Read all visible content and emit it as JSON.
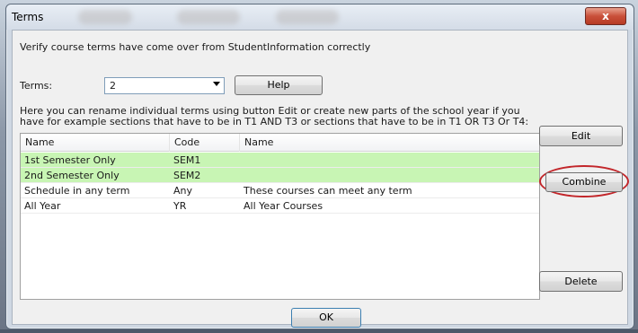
{
  "window": {
    "title": "Terms",
    "close_label": "x"
  },
  "verify_text": "Verify course terms have come over from StudentInformation correctly",
  "terms": {
    "label": "Terms:",
    "selected": "2"
  },
  "help_label": "Help",
  "description": "Here you can rename individual terms using button Edit or create new parts of the school year if you have for example sections that have to be in T1 AND T3 or sections that have to be in T1 OR T3 Or T4:",
  "grid": {
    "columns": [
      "Name",
      "Code",
      "Name"
    ],
    "rows": [
      {
        "name": "1st Semester Only",
        "code": "SEM1",
        "desc": "",
        "highlight": true
      },
      {
        "name": "2nd Semester Only",
        "code": "SEM2",
        "desc": "",
        "highlight": true
      },
      {
        "name": "Schedule in any term",
        "code": "Any",
        "desc": "These courses can meet any term",
        "highlight": false
      },
      {
        "name": "All Year",
        "code": "YR",
        "desc": "All Year Courses",
        "highlight": false
      }
    ]
  },
  "buttons": {
    "edit": "Edit",
    "combine": "Combine",
    "delete": "Delete",
    "ok": "OK"
  },
  "colors": {
    "highlight_row": "#c8f5b4",
    "annotation_ring": "#c2262a",
    "close_button": "#c9503a"
  }
}
